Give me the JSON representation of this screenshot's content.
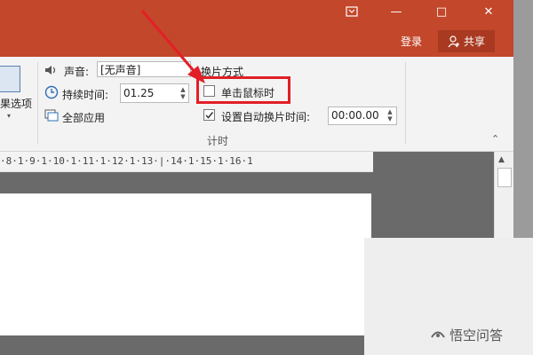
{
  "window_controls": {
    "restore_ribbon_icon": "ribbon-display-icon",
    "minimize": "—",
    "maximize": "□",
    "close": "✕"
  },
  "account": {
    "sign_in": "登录",
    "share": "共享"
  },
  "ribbon": {
    "effect_options_label": "果选项",
    "sound_label": "声音:",
    "sound_value": "[无声音]",
    "duration_label": "持续时间:",
    "duration_value": "01.25",
    "apply_all_label": "全部应用",
    "advance_title": "换片方式",
    "on_click_label": "单击鼠标时",
    "on_click_checked": false,
    "after_label": "设置自动换片时间:",
    "after_checked": true,
    "after_value": "00:00.00",
    "group_label": "计时"
  },
  "ruler": {
    "text": "·8·1·9·1·10·1·11·1·12·1·13·|·14·1·15·1·16·1"
  },
  "watermark": {
    "text": "悟空问答"
  },
  "colors": {
    "titlebar": "#c3472b",
    "highlight_box": "#e21f26",
    "arrow": "#e21f26"
  }
}
